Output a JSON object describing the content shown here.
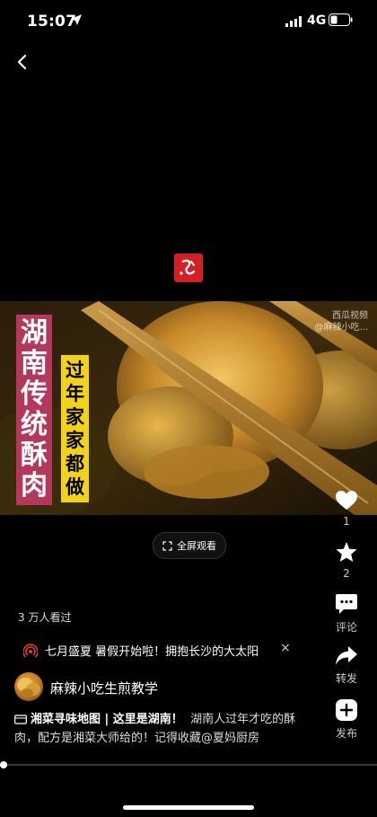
{
  "status_bar": {
    "time": "15:07",
    "network": "4G"
  },
  "video": {
    "title": [
      "湖",
      "南",
      "传",
      "统",
      "酥",
      "肉"
    ],
    "subtitle": [
      "过",
      "年",
      "家",
      "家",
      "都",
      "做"
    ],
    "watermark_line1": "西瓜视频",
    "watermark_line2": "@麻辣小吃..."
  },
  "fullscreen": {
    "label": "全屏观看"
  },
  "actions": {
    "like_count": "1",
    "favorite_count": "2",
    "comment_label": "评论",
    "share_label": "转发",
    "publish_label": "发布"
  },
  "views": "3 万人看过",
  "promo": {
    "text": "七月盛夏 暑假开始啦！拥抱长沙的大太阳",
    "close": "×"
  },
  "author": {
    "name": "麻辣小吃生煎教学"
  },
  "description": {
    "hashtag": "湘菜寻味地图 | 这里是湖南！",
    "text": "湖南人过年才吃的酥肉，配方是湘菜大师给的！记得收藏@夏妈厨房"
  },
  "progress": {
    "fraction": 0.01
  },
  "colors": {
    "background": "#000000",
    "logo_red": "#d32027",
    "title_bg": "#b4385c",
    "subtitle_bg": "#f3d21a",
    "promo_icon": "#e03a3a"
  }
}
